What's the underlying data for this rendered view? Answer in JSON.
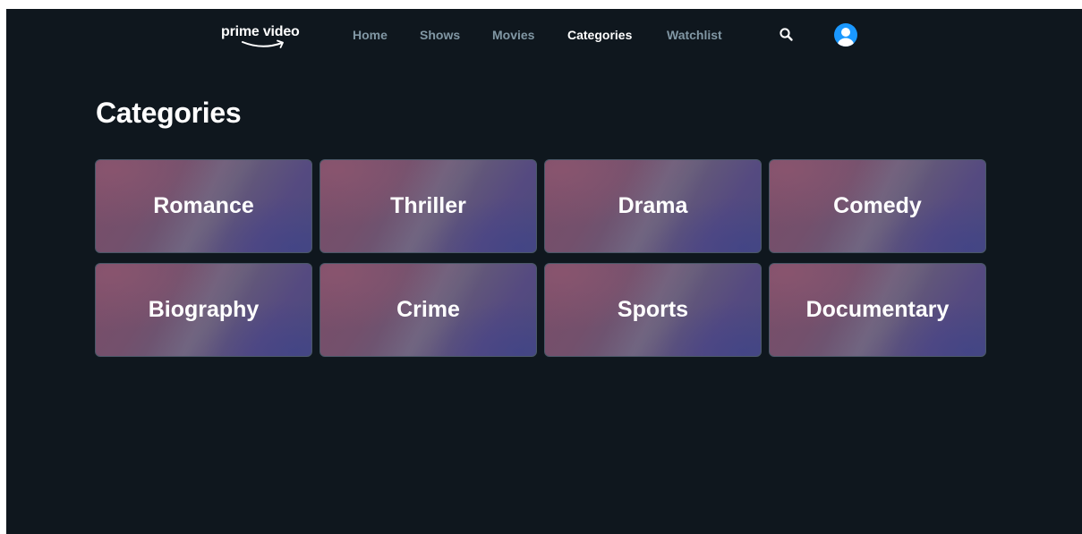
{
  "app": {
    "brand": "prime video"
  },
  "nav": {
    "items": [
      {
        "label": "Home",
        "active": false
      },
      {
        "label": "Shows",
        "active": false
      },
      {
        "label": "Movies",
        "active": false
      },
      {
        "label": "Categories",
        "active": true
      },
      {
        "label": "Watchlist",
        "active": false
      }
    ],
    "search_icon": "search-icon",
    "profile_icon": "user-avatar-icon"
  },
  "page": {
    "title": "Categories"
  },
  "categories": [
    {
      "label": "Romance"
    },
    {
      "label": "Thriller"
    },
    {
      "label": "Drama"
    },
    {
      "label": "Comedy"
    },
    {
      "label": "Biography"
    },
    {
      "label": "Crime"
    },
    {
      "label": "Sports"
    },
    {
      "label": "Documentary"
    }
  ],
  "colors": {
    "background": "#0f171e",
    "nav_inactive": "#8197a4",
    "nav_active": "#ffffff",
    "avatar": "#1a98ff",
    "tile_border": "#4a5868"
  }
}
